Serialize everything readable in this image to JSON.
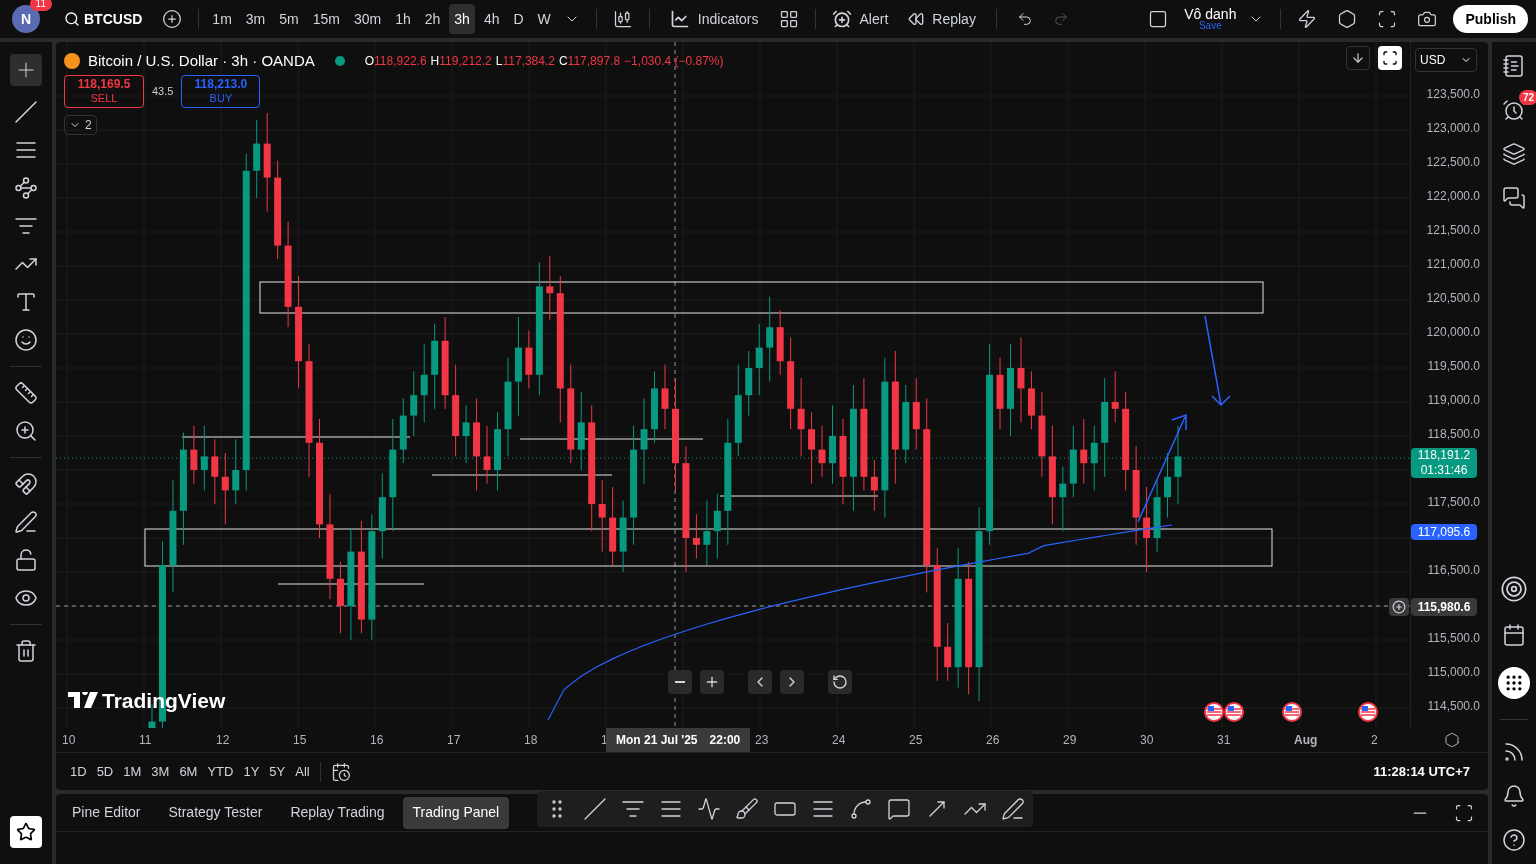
{
  "top_bar": {
    "avatar": "N",
    "notifications": "11",
    "symbol": "BTCUSD",
    "intervals": [
      {
        "label": "1m",
        "selected": false
      },
      {
        "label": "3m",
        "selected": false
      },
      {
        "label": "5m",
        "selected": false
      },
      {
        "label": "15m",
        "selected": false
      },
      {
        "label": "30m",
        "selected": false
      },
      {
        "label": "1h",
        "selected": false
      },
      {
        "label": "2h",
        "selected": false
      },
      {
        "label": "3h",
        "selected": true
      },
      {
        "label": "4h",
        "selected": false
      },
      {
        "label": "D",
        "selected": false
      },
      {
        "label": "W",
        "selected": false
      }
    ],
    "indicators": "Indicators",
    "alert": "Alert",
    "replay": "Replay",
    "layout_name": "Vô danh",
    "save": "Save",
    "publish": "Publish"
  },
  "legend": {
    "title": "Bitcoin / U.S. Dollar · 3h · OANDA",
    "market_open": true,
    "ohlc": [
      {
        "key": "O",
        "value": "118,922.6"
      },
      {
        "key": "H",
        "value": "119,212.2"
      },
      {
        "key": "L",
        "value": "117,384.2"
      },
      {
        "key": "C",
        "value": "117,897.8"
      }
    ],
    "change": "−1,030.4 (−0.87%)",
    "sell": {
      "price": "118,169.5",
      "label": "SELL"
    },
    "spread": "43.5",
    "buy": {
      "price": "118,213.0",
      "label": "BUY"
    },
    "collapsed_count": "2"
  },
  "price_axis": {
    "currency": "USD",
    "ticks": [
      "123,500.0",
      "123,000.0",
      "122,500.0",
      "122,000.0",
      "121,500.0",
      "121,000.0",
      "120,500.0",
      "120,000.0",
      "119,500.0",
      "119,000.0",
      "118,500.0",
      "117,500.0",
      "116,500.0",
      "115,500.0",
      "115,000.0",
      "114,500.0"
    ],
    "last_price": "118,191.2",
    "countdown": "01:31:46",
    "ma_price": "117,095.6",
    "crosshair_price": "115,980.6"
  },
  "logo": "TradingView",
  "time_axis": {
    "ticks": [
      "10",
      "11",
      "12",
      "15",
      "16",
      "17",
      "18",
      "1",
      "23",
      "24",
      "25",
      "26",
      "29",
      "30",
      "31",
      "Aug",
      "2"
    ],
    "crosshair_date": "Mon 21 Jul '25",
    "crosshair_time": "22:00"
  },
  "ranges": [
    "1D",
    "5D",
    "1M",
    "3M",
    "6M",
    "YTD",
    "1Y",
    "5Y",
    "All"
  ],
  "clock": "11:28:14 UTC+7",
  "bottom_tabs": [
    {
      "label": "Pine Editor",
      "selected": false
    },
    {
      "label": "Strategy Tester",
      "selected": false
    },
    {
      "label": "Replay Trading",
      "selected": false
    },
    {
      "label": "Trading Panel",
      "selected": true
    }
  ],
  "right_sidebar": {
    "alerts_badge": "72"
  }
}
